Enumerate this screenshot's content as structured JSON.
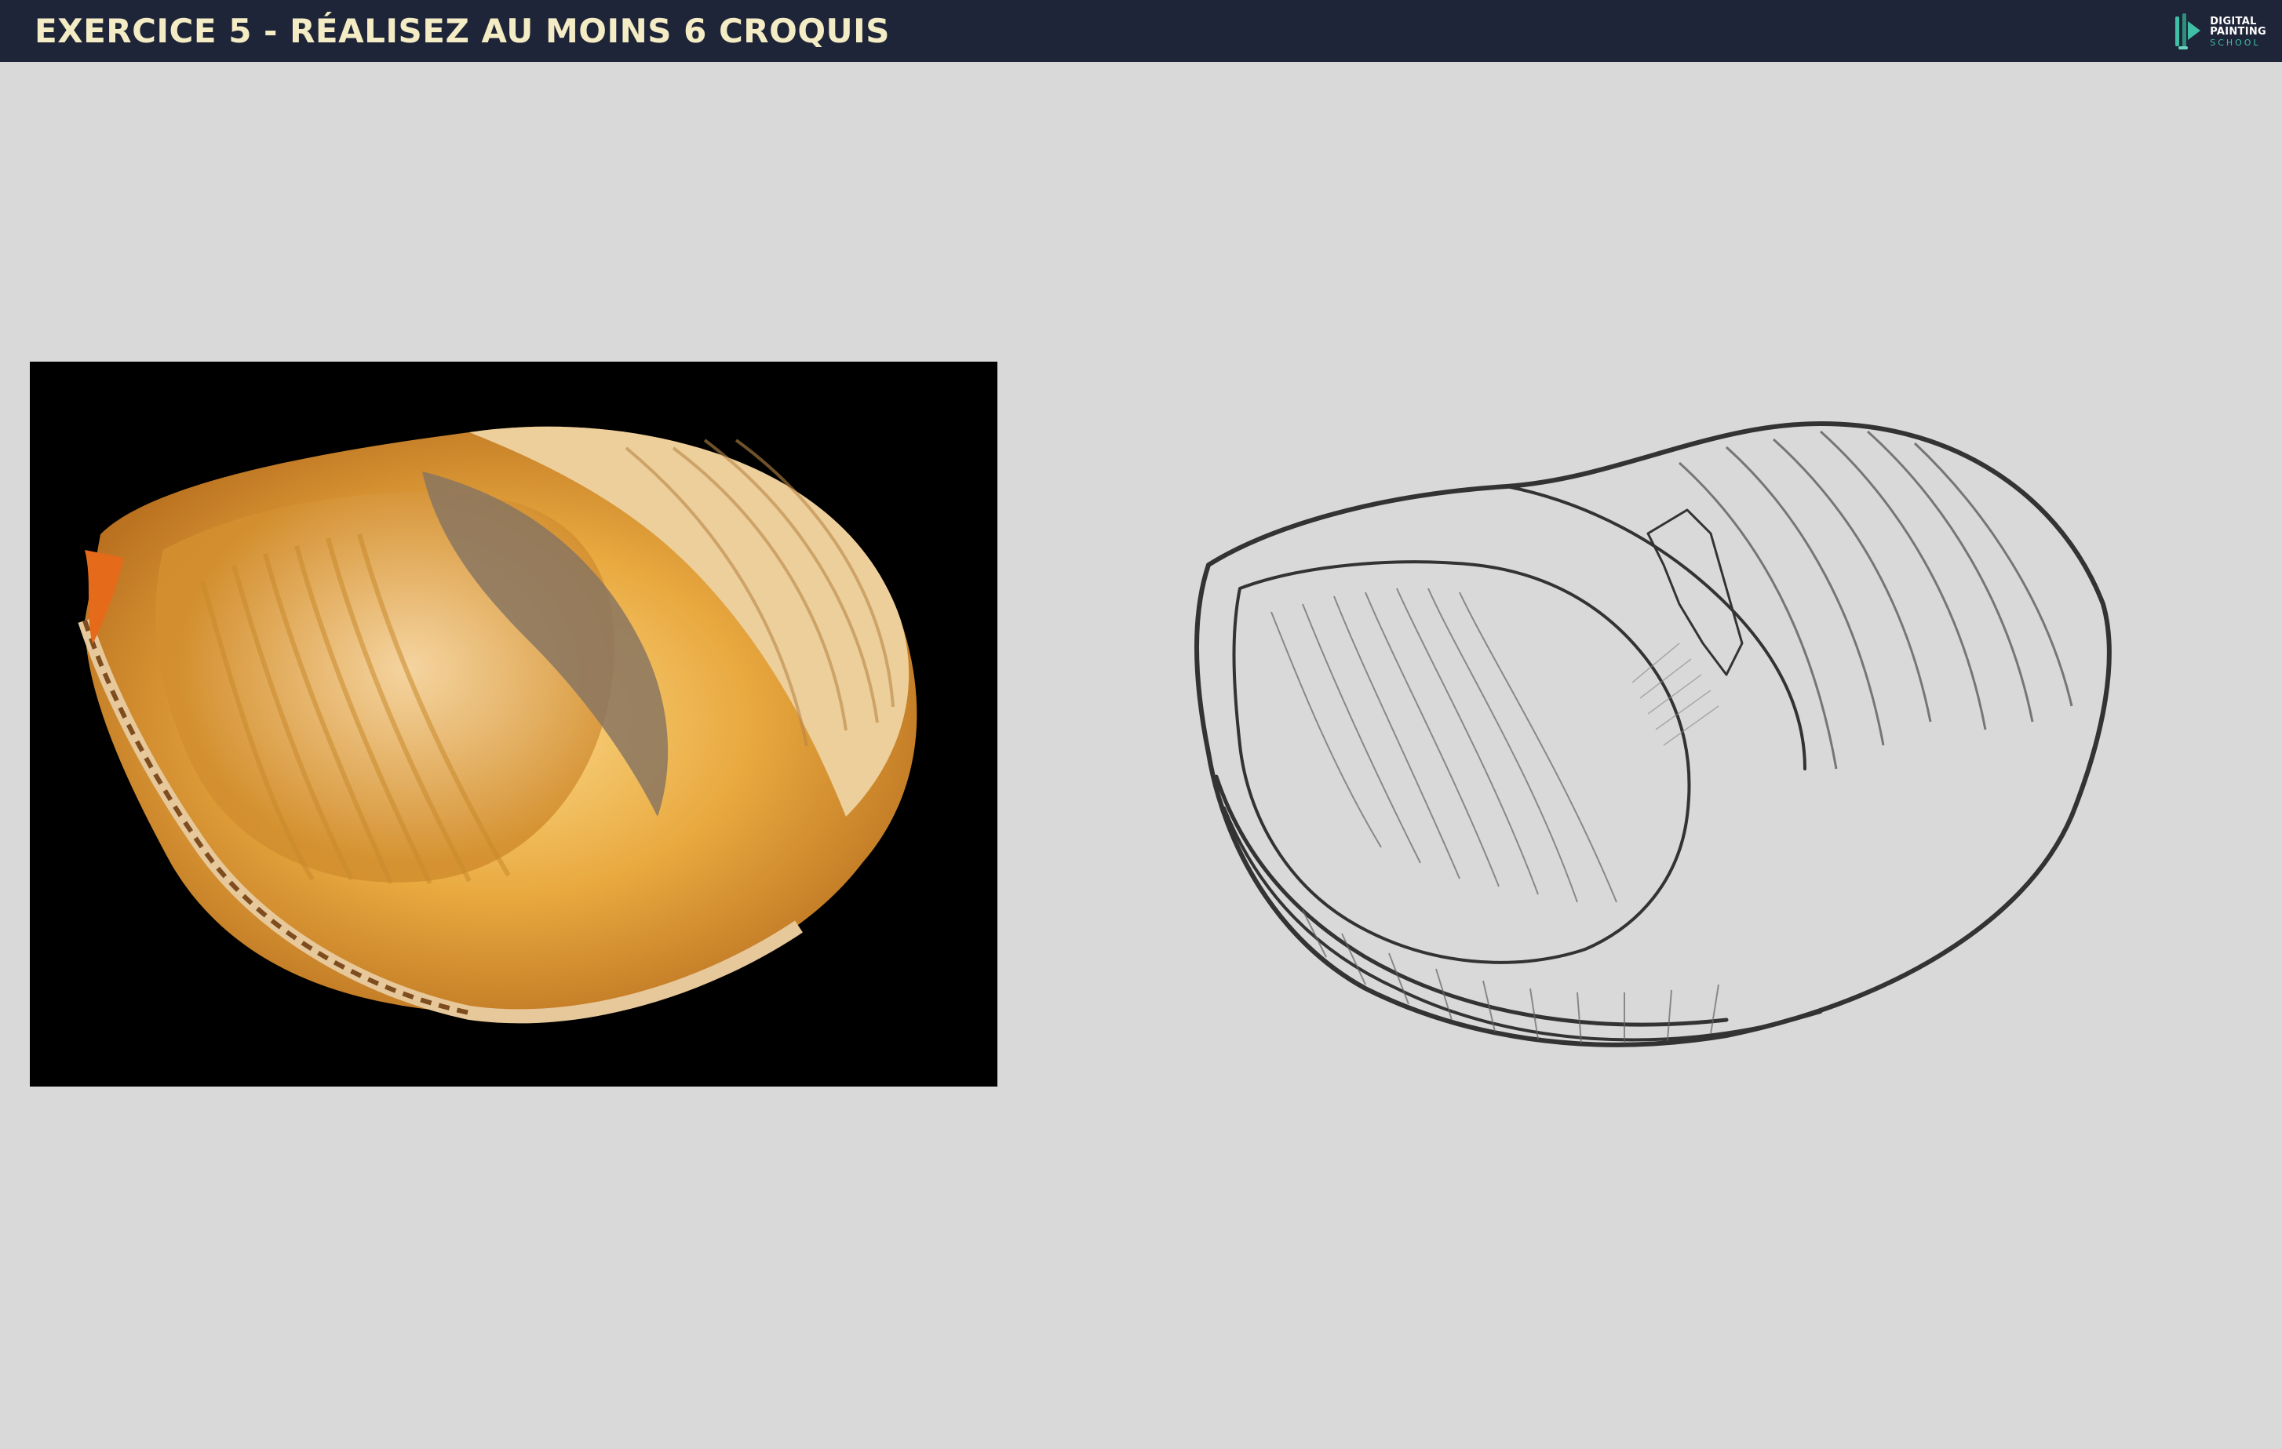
{
  "header": {
    "title": "EXERCICE 5 - RÉALISEZ AU MOINS 6 CROQUIS",
    "logo": {
      "icon": "brush-pen-logo-icon",
      "line1": "DIGITAL",
      "line2": "PAINTING",
      "line3": "SCHOOL"
    }
  },
  "colors": {
    "header_bg": "#1f2538",
    "title_text": "#f4ecc4",
    "logo_accent": "#3fbfa6",
    "canvas_bg": "#d9d9d9",
    "photo_bg": "#000000"
  },
  "content": {
    "reference_photo": "seashell-photo",
    "sketch": "seashell-line-sketch"
  }
}
